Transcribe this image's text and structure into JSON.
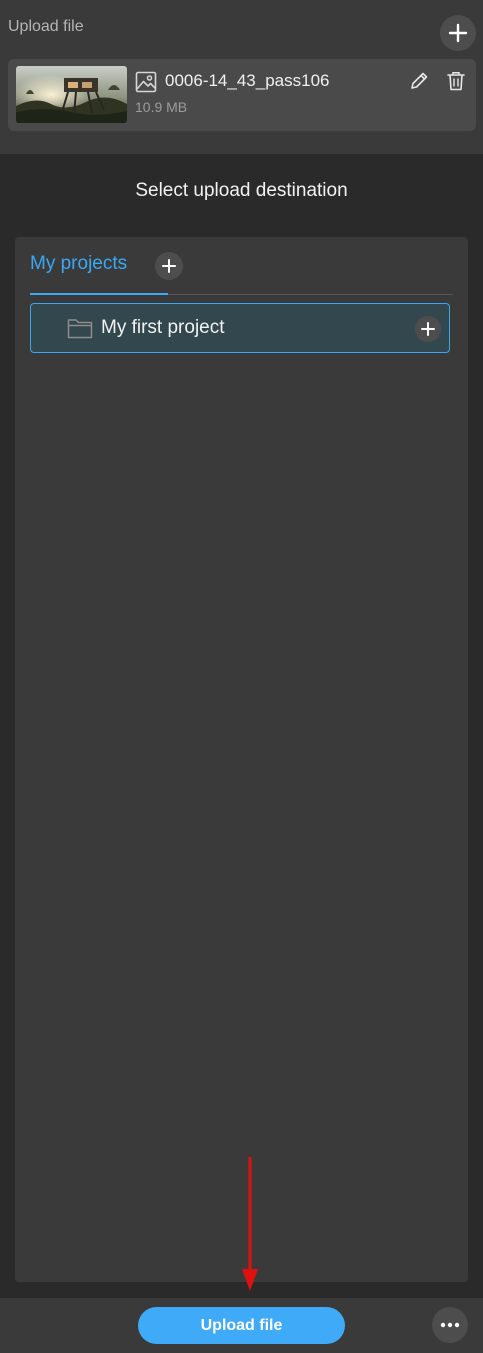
{
  "header": {
    "title": "Upload file",
    "add_icon": "plus-icon"
  },
  "file": {
    "name": "0006-14_43_pass106",
    "size": "10.9 MB",
    "type_icon": "image-icon",
    "edit_icon": "pencil-icon",
    "delete_icon": "trash-icon"
  },
  "destination": {
    "title": "Select upload destination",
    "tabs": [
      {
        "label": "My projects",
        "active": true
      }
    ],
    "projects": [
      {
        "name": "My first project",
        "icon": "folder-icon"
      }
    ]
  },
  "footer": {
    "upload_label": "Upload file",
    "more_icon": "ellipsis-icon"
  },
  "colors": {
    "accent": "#3aa8f5",
    "button": "#3eaaf8",
    "annotation_arrow": "#e01010"
  }
}
